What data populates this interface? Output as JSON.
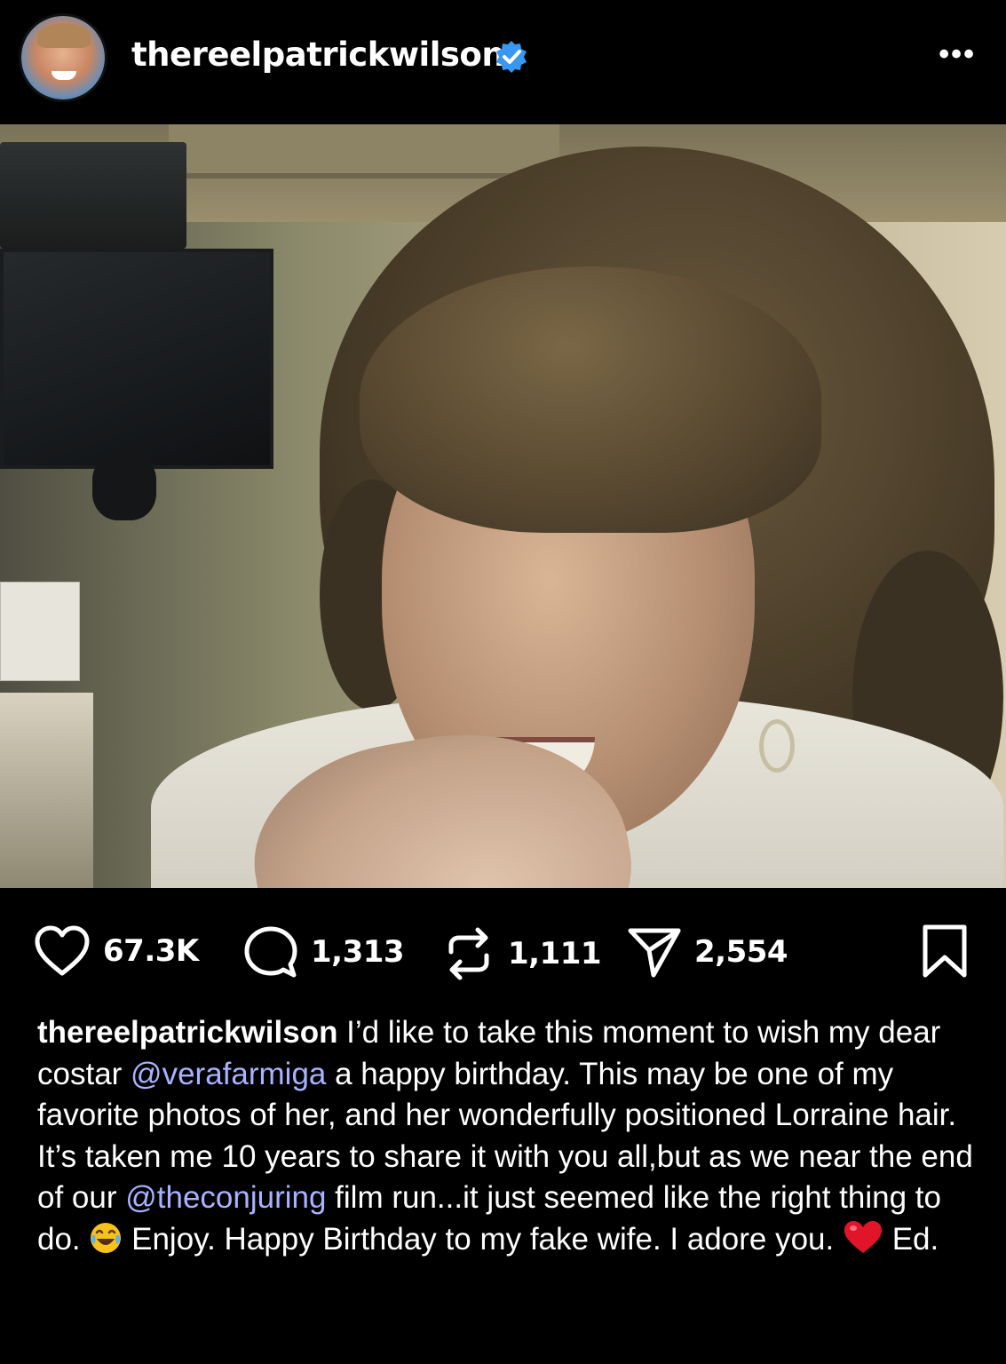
{
  "post": {
    "username": "thereelpatrickwilson",
    "verified_icon": "verified-badge-icon",
    "more_label": "•••",
    "photo_icon": "post-photo",
    "stats": {
      "likes": "67.3K",
      "comments": "1,313",
      "reposts": "1,111",
      "shares": "2,554"
    },
    "caption": {
      "username": "thereelpatrickwilson",
      "part1": " I’d like to take this moment to wish my dear costar ",
      "mention1": "@verafarmiga",
      "part2": " a happy birthday. This may be one of my favorite photos of her, and her wonderfully positioned Lorraine hair. It’s taken me 10 years to share it with you all,but as we near the end of our ",
      "mention2": "@theconjuring",
      "part3": " film run...it just seemed like the right thing to do. ",
      "part4": " Enjoy. Happy Birthday to my fake wife. I adore you. ",
      "part5": " Ed."
    },
    "colors": {
      "background": "#000000",
      "verified": "#3897f0",
      "mention": "#a8b2ff",
      "heart_emoji": "#e0152a"
    }
  }
}
